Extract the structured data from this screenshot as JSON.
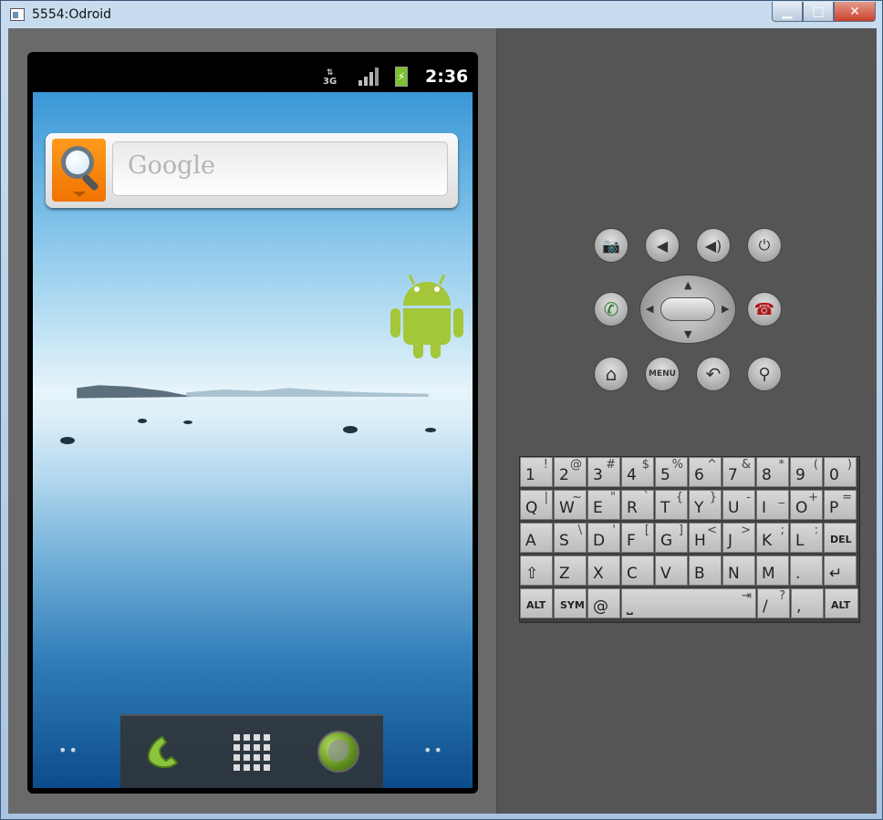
{
  "window": {
    "title": "5554:Odroid",
    "min_glyph": "▁",
    "max_glyph": "□",
    "close_glyph": "✕"
  },
  "status_bar": {
    "network": "3G",
    "time": "2:36",
    "battery_glyph": "⚡"
  },
  "search_widget": {
    "placeholder": "Google"
  },
  "dock": {
    "left_dots": "••",
    "right_dots": "••"
  },
  "hardware_buttons": {
    "camera": "📷",
    "volume_down": "◀",
    "volume_up": "◀)",
    "power": "⏻",
    "call": "✆",
    "end_call": "☎",
    "home": "⌂",
    "menu": "MENU",
    "back": "↶",
    "search": "⚲"
  },
  "keyboard": {
    "rows": [
      [
        [
          "1",
          "!"
        ],
        [
          "2",
          "@"
        ],
        [
          "3",
          "#"
        ],
        [
          "4",
          "$"
        ],
        [
          "5",
          "%"
        ],
        [
          "6",
          "^"
        ],
        [
          "7",
          "&"
        ],
        [
          "8",
          "*"
        ],
        [
          "9",
          "("
        ],
        [
          "0",
          ")"
        ]
      ],
      [
        [
          "Q",
          "|"
        ],
        [
          "W",
          "~"
        ],
        [
          "E",
          "\""
        ],
        [
          "R",
          "`"
        ],
        [
          "T",
          "{"
        ],
        [
          "Y",
          "}"
        ],
        [
          "U",
          "-"
        ],
        [
          "I",
          "_"
        ],
        [
          "O",
          "+"
        ],
        [
          "P",
          "="
        ]
      ],
      [
        [
          "A",
          ""
        ],
        [
          "S",
          "\\"
        ],
        [
          "D",
          "'"
        ],
        [
          "F",
          "["
        ],
        [
          "G",
          "]"
        ],
        [
          "H",
          "<"
        ],
        [
          "J",
          ">"
        ],
        [
          "K",
          ";"
        ],
        [
          "L",
          ":"
        ],
        [
          "DEL",
          ""
        ]
      ],
      [
        [
          "⇧",
          ""
        ],
        [
          "Z",
          ""
        ],
        [
          "X",
          ""
        ],
        [
          "C",
          ""
        ],
        [
          "V",
          ""
        ],
        [
          "B",
          ""
        ],
        [
          "N",
          ""
        ],
        [
          "M",
          ""
        ],
        [
          ".",
          ""
        ],
        [
          "↵",
          ""
        ]
      ]
    ],
    "bottom_row": {
      "alt_left": "ALT",
      "sym": "SYM",
      "at": "@",
      "space": "⎵",
      "tab": "⇥",
      "slash": "/",
      "question": "?",
      "comma": ",",
      "alt_right": "ALT"
    }
  }
}
